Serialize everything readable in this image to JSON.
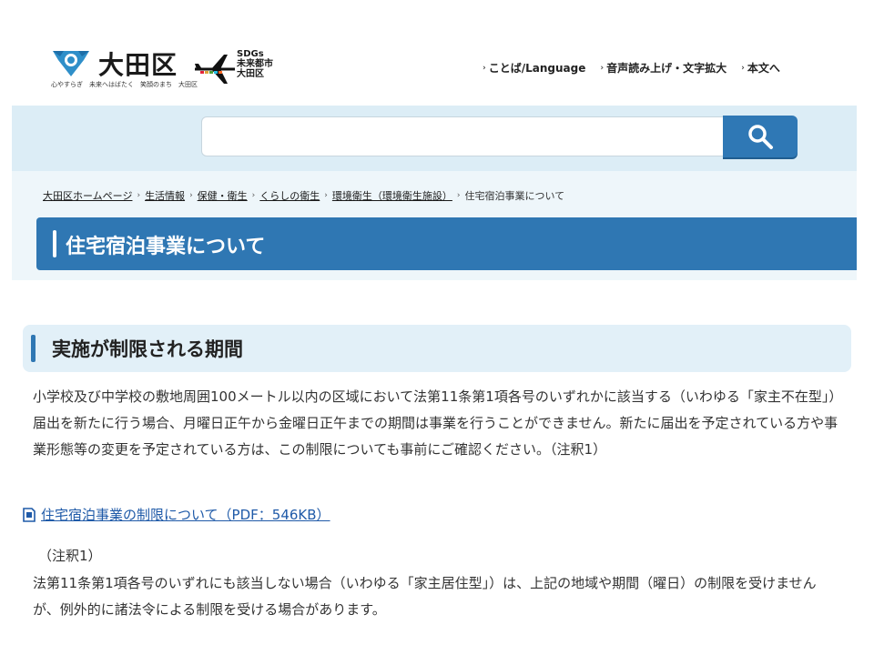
{
  "header": {
    "logo_name": "大田区",
    "logo_tagline": "心やすらぎ　未来へはばたく　笑顔のまち　大田区",
    "sdgs_lines": [
      "SDGs",
      "未来都市",
      "大田区"
    ],
    "util_nav": [
      {
        "label": "ことば/Language"
      },
      {
        "label": "音声読み上げ・文字拡大"
      },
      {
        "label": "本文へ"
      }
    ]
  },
  "search": {
    "placeholder": "",
    "value": "",
    "icon": "search-icon"
  },
  "breadcrumb": {
    "items": [
      {
        "label": "大田区ホームページ"
      },
      {
        "label": "生活情報"
      },
      {
        "label": "保健・衛生"
      },
      {
        "label": "くらしの衛生"
      },
      {
        "label": "環境衛生（環境衛生施設）"
      }
    ],
    "current": "住宅宿泊事業について"
  },
  "page": {
    "title": "住宅宿泊事業について"
  },
  "section": {
    "heading": "実施が制限される期間",
    "paragraph_1": "小学校及び中学校の敷地周囲100メートル以内の区域において法第11条第1項各号のいずれかに該当する（いわゆる「家主不在型」）届出を新たに行う場合、月曜日正午から金曜日正午までの期間は事業を行うことができません。新たに届出を予定されている方や事業形態等の変更を予定されている方は、この制限についても事前にご確認ください。（注釈1）",
    "pdf_link": "住宅宿泊事業の制限について（PDF：546KB）",
    "note_label": "（注釈1）",
    "paragraph_2": "法第11条第1項各号のいずれにも該当しない場合（いわゆる「家主居住型」）は、上記の地域や期間（曜日）の制限を受けませんが、例外的に諸法令による制限を受ける場合があります。"
  },
  "colors": {
    "primary_blue": "#2f77b3",
    "search_band": "#dcedf6",
    "crumb_band": "#eef6fa",
    "heading_bg": "#e2f0f8",
    "link": "#1f5aa8"
  }
}
